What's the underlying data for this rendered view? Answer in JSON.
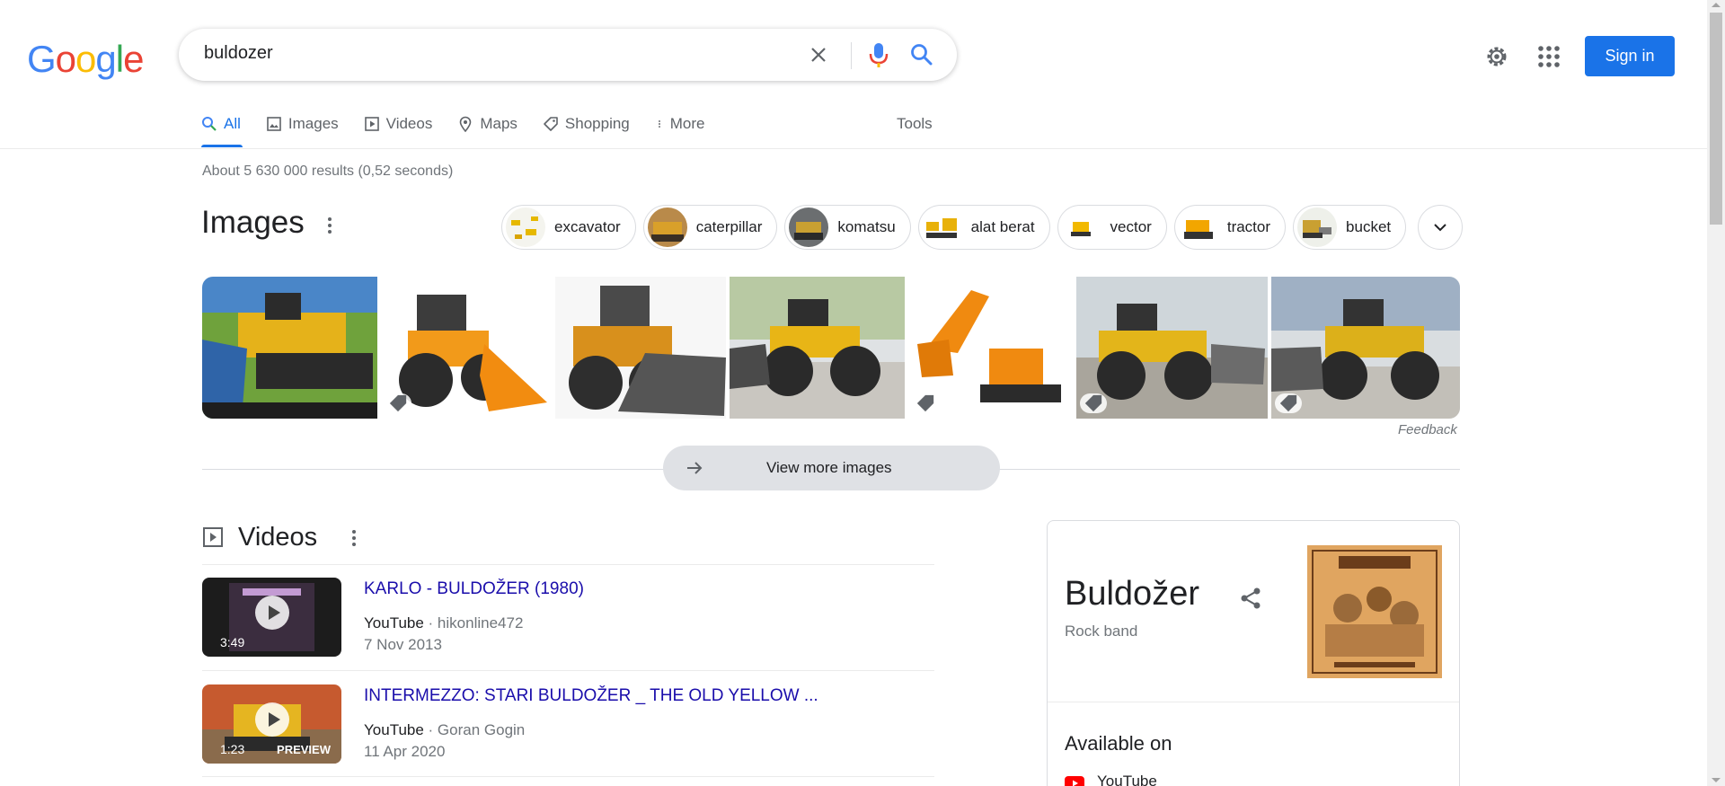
{
  "logo": {
    "letters": [
      "G",
      "o",
      "o",
      "g",
      "l",
      "e"
    ]
  },
  "search": {
    "query": "buldozer"
  },
  "header": {
    "signin_label": "Sign in"
  },
  "tabs": [
    {
      "label": "All",
      "icon": "search-icon"
    },
    {
      "label": "Images",
      "icon": "image-icon"
    },
    {
      "label": "Videos",
      "icon": "video-icon"
    },
    {
      "label": "Maps",
      "icon": "map-pin-icon"
    },
    {
      "label": "Shopping",
      "icon": "tag-icon"
    },
    {
      "label": "More",
      "icon": "more-vert-icon"
    }
  ],
  "tools_label": "Tools",
  "result_stats": "About 5 630 000 results (0,52 seconds)",
  "images": {
    "title": "Images",
    "chips": [
      "excavator",
      "caterpillar",
      "komatsu",
      "alat berat",
      "vector",
      "tractor",
      "bucket"
    ],
    "feedback": "Feedback",
    "view_more": "View more images"
  },
  "videos": {
    "title": "Videos",
    "items": [
      {
        "title": "KARLO - BULDOŽER (1980)",
        "source": "YouTube",
        "channel": "· hikonline472",
        "date": "7 Nov 2013",
        "duration": "3:49",
        "badge": ""
      },
      {
        "title": "INTERMEZZO: STARI BULDOŽER _ THE OLD YELLOW ...",
        "source": "YouTube",
        "channel": "· Goran Gogin",
        "date": "11 Apr 2020",
        "duration": "1:23",
        "badge": "PREVIEW"
      }
    ]
  },
  "knowledge_panel": {
    "title": "Buldožer",
    "subtitle": "Rock band",
    "available_on": "Available on",
    "platform": "YouTube"
  },
  "colors": {
    "accent": "#1a73e8",
    "link": "#1a0dab",
    "muted": "#70757a"
  }
}
